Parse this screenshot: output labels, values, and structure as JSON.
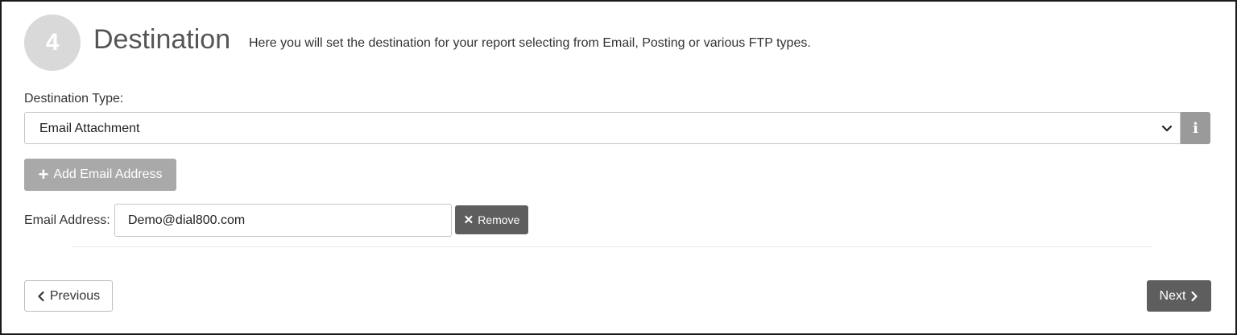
{
  "step": {
    "number": "4",
    "title": "Destination",
    "description": "Here you will set the destination for your report selecting from Email, Posting or various FTP types."
  },
  "destination": {
    "label": "Destination Type:",
    "selected": "Email Attachment",
    "info_icon": "info-icon"
  },
  "email": {
    "add_button_label": "Add Email Address",
    "field_label": "Email Address:",
    "value": "Demo@dial800.com",
    "remove_button_label": "Remove"
  },
  "navigation": {
    "previous_label": "Previous",
    "next_label": "Next"
  },
  "colors": {
    "circle": "#d9d9d9",
    "info_button": "#9a9a9a",
    "add_button": "#a9a9a9",
    "dark_button": "#5e5e5e"
  }
}
